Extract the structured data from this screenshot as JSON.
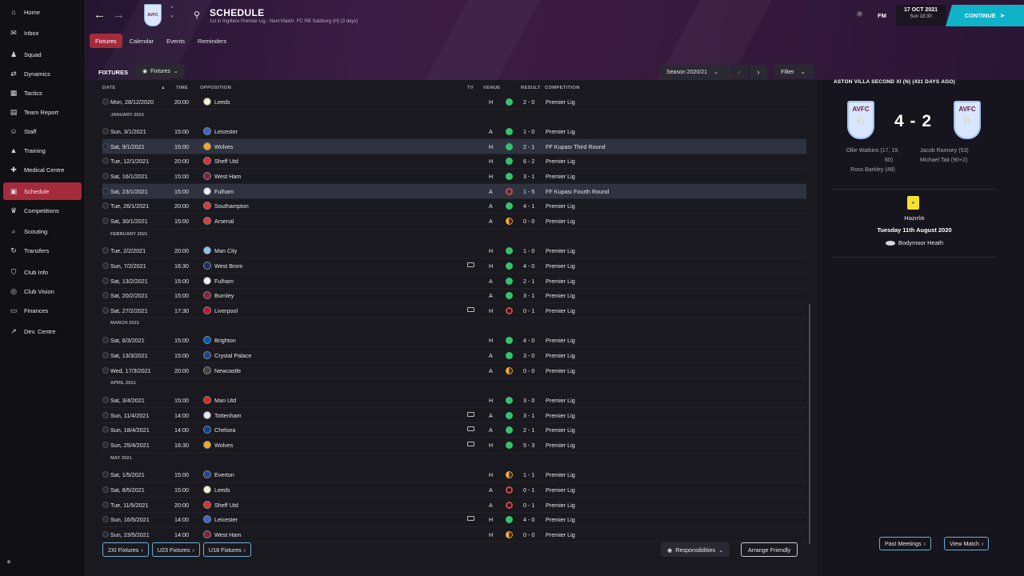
{
  "sidebar": {
    "items": [
      {
        "label": "Home",
        "icon": "⌂"
      },
      {
        "label": "Inbox",
        "icon": "✉"
      },
      {
        "label": "Squad",
        "icon": "♟"
      },
      {
        "label": "Dynamics",
        "icon": "⇄"
      },
      {
        "label": "Tactics",
        "icon": "▦"
      },
      {
        "label": "Team Report",
        "icon": "▤"
      },
      {
        "label": "Staff",
        "icon": "☺"
      },
      {
        "label": "Training",
        "icon": "▲"
      },
      {
        "label": "Medical Centre",
        "icon": "✚"
      },
      {
        "label": "Schedule",
        "icon": "▣"
      },
      {
        "label": "Competitions",
        "icon": "♛"
      },
      {
        "label": "Scouting",
        "icon": "⌕"
      },
      {
        "label": "Transfers",
        "icon": "↻"
      },
      {
        "label": "Club Info",
        "icon": "⛉"
      },
      {
        "label": "Club Vision",
        "icon": "◎"
      },
      {
        "label": "Finances",
        "icon": "▭"
      },
      {
        "label": "Dev. Centre",
        "icon": "↗"
      }
    ]
  },
  "header": {
    "title": "SCHEDULE",
    "subtitle": "1st in İngiltere Premier Lig - Next Match: FC RB Salzburg (H) (3 days)",
    "tabs": [
      "Fixtures",
      "Calendar",
      "Events",
      "Reminders"
    ],
    "fm_label": "FM",
    "date": "17 OCT 2021",
    "time": "Sun 18:30",
    "continue_label": "CONTINUE"
  },
  "fixtures": {
    "section_title": "FIXTURES",
    "view_label": "Fixtures",
    "season_label": "Season 2020/21",
    "filter_label": "Filter",
    "columns": {
      "date": "DATE",
      "time": "TIME",
      "opposition": "OPPOSITION",
      "tv": "TV",
      "venue": "VENUE",
      "result": "RESULT",
      "competition": "COMPETITION"
    },
    "rows": [
      {
        "type": "match",
        "date": "Mon, 28/12/2020",
        "time": "20:00",
        "opp": "Leeds",
        "crest": "#f4f0d6",
        "tv": false,
        "venue": "H",
        "res": "w",
        "score": "2 - 0",
        "comp": "Premier Lig"
      },
      {
        "type": "month",
        "label": "JANUARY 2021"
      },
      {
        "type": "match",
        "date": "Sun, 3/1/2021",
        "time": "15:00",
        "opp": "Leicester",
        "crest": "#3d64c9",
        "tv": false,
        "venue": "A",
        "res": "w",
        "score": "1 - 0",
        "comp": "Premier Lig"
      },
      {
        "type": "match",
        "date": "Sat, 9/1/2021",
        "time": "15:00",
        "opp": "Wolves",
        "crest": "#f5a623",
        "tv": false,
        "venue": "H",
        "res": "w",
        "score": "2 - 1",
        "comp": "FF Kupası Third Round",
        "hl": true
      },
      {
        "type": "match",
        "date": "Tue, 12/1/2021",
        "time": "20:00",
        "opp": "Sheff Utd",
        "crest": "#d93030",
        "tv": false,
        "venue": "H",
        "res": "w",
        "score": "6 - 2",
        "comp": "Premier Lig"
      },
      {
        "type": "match",
        "date": "Sat, 16/1/2021",
        "time": "15:00",
        "opp": "West Ham",
        "crest": "#7d2338",
        "tv": false,
        "venue": "H",
        "res": "w",
        "score": "3 - 1",
        "comp": "Premier Lig"
      },
      {
        "type": "match",
        "date": "Sat, 23/1/2021",
        "time": "15:00",
        "opp": "Fulham",
        "crest": "#f0f0f0",
        "tv": false,
        "venue": "A",
        "res": "l",
        "score": "1 - 5",
        "comp": "FF Kupası Fourth Round",
        "hl": true
      },
      {
        "type": "match",
        "date": "Tue, 26/1/2021",
        "time": "20:00",
        "opp": "Southampton",
        "crest": "#d63a3a",
        "tv": false,
        "venue": "A",
        "res": "w",
        "score": "4 - 1",
        "comp": "Premier Lig"
      },
      {
        "type": "match",
        "date": "Sat, 30/1/2021",
        "time": "15:00",
        "opp": "Arsenal",
        "crest": "#e03a3a",
        "tv": false,
        "venue": "A",
        "res": "d",
        "score": "0 - 0",
        "comp": "Premier Lig"
      },
      {
        "type": "month",
        "label": "FEBRUARY 2021"
      },
      {
        "type": "match",
        "date": "Tue, 2/2/2021",
        "time": "20:00",
        "opp": "Man City",
        "crest": "#8cc3ea",
        "tv": false,
        "venue": "H",
        "res": "w",
        "score": "1 - 0",
        "comp": "Premier Lig"
      },
      {
        "type": "match",
        "date": "Sun, 7/2/2021",
        "time": "16:30",
        "opp": "West Brom",
        "crest": "#1c2e6b",
        "tv": true,
        "venue": "H",
        "res": "w",
        "score": "4 - 0",
        "comp": "Premier Lig"
      },
      {
        "type": "match",
        "date": "Sat, 13/2/2021",
        "time": "15:00",
        "opp": "Fulham",
        "crest": "#f0f0f0",
        "tv": false,
        "venue": "A",
        "res": "w",
        "score": "2 - 1",
        "comp": "Premier Lig"
      },
      {
        "type": "match",
        "date": "Sat, 20/2/2021",
        "time": "15:00",
        "opp": "Burnley",
        "crest": "#8a1f3e",
        "tv": false,
        "venue": "A",
        "res": "w",
        "score": "3 - 1",
        "comp": "Premier Lig"
      },
      {
        "type": "match",
        "date": "Sat, 27/2/2021",
        "time": "17:30",
        "opp": "Liverpool",
        "crest": "#c8102e",
        "tv": true,
        "venue": "H",
        "res": "l",
        "score": "0 - 1",
        "comp": "Premier Lig"
      },
      {
        "type": "month",
        "label": "MARCH 2021"
      },
      {
        "type": "match",
        "date": "Sat, 6/3/2021",
        "time": "15:00",
        "opp": "Brighton",
        "crest": "#0057b8",
        "tv": false,
        "venue": "H",
        "res": "w",
        "score": "4 - 0",
        "comp": "Premier Lig"
      },
      {
        "type": "match",
        "date": "Sat, 13/3/2021",
        "time": "15:00",
        "opp": "Crystal Palace",
        "crest": "#1b458f",
        "tv": false,
        "venue": "A",
        "res": "w",
        "score": "3 - 0",
        "comp": "Premier Lig"
      },
      {
        "type": "match",
        "date": "Wed, 17/3/2021",
        "time": "20:00",
        "opp": "Newcastle",
        "crest": "#444444",
        "tv": false,
        "venue": "A",
        "res": "d",
        "score": "0 - 0",
        "comp": "Premier Lig"
      },
      {
        "type": "month",
        "label": "APRIL 2021"
      },
      {
        "type": "match",
        "date": "Sat, 3/4/2021",
        "time": "15:00",
        "opp": "Man Utd",
        "crest": "#da291c",
        "tv": false,
        "venue": "H",
        "res": "w",
        "score": "3 - 0",
        "comp": "Premier Lig"
      },
      {
        "type": "match",
        "date": "Sun, 11/4/2021",
        "time": "14:00",
        "opp": "Tottenham",
        "crest": "#e8e8f0",
        "tv": true,
        "venue": "A",
        "res": "w",
        "score": "3 - 1",
        "comp": "Premier Lig"
      },
      {
        "type": "match",
        "date": "Sun, 18/4/2021",
        "time": "14:00",
        "opp": "Chelsea",
        "crest": "#034694",
        "tv": true,
        "venue": "A",
        "res": "w",
        "score": "2 - 1",
        "comp": "Premier Lig"
      },
      {
        "type": "match",
        "date": "Sun, 25/4/2021",
        "time": "16:30",
        "opp": "Wolves",
        "crest": "#f5a623",
        "tv": true,
        "venue": "H",
        "res": "w",
        "score": "5 - 3",
        "comp": "Premier Lig"
      },
      {
        "type": "month",
        "label": "MAY 2021"
      },
      {
        "type": "match",
        "date": "Sat, 1/5/2021",
        "time": "15:00",
        "opp": "Everton",
        "crest": "#274488",
        "tv": false,
        "venue": "H",
        "res": "d",
        "score": "1 - 1",
        "comp": "Premier Lig"
      },
      {
        "type": "match",
        "date": "Sat, 8/5/2021",
        "time": "15:00",
        "opp": "Leeds",
        "crest": "#f4f0d6",
        "tv": false,
        "venue": "A",
        "res": "l",
        "score": "0 - 1",
        "comp": "Premier Lig"
      },
      {
        "type": "match",
        "date": "Tue, 11/5/2021",
        "time": "20:00",
        "opp": "Sheff Utd",
        "crest": "#d93030",
        "tv": false,
        "venue": "A",
        "res": "l",
        "score": "0 - 1",
        "comp": "Premier Lig"
      },
      {
        "type": "match",
        "date": "Sun, 16/5/2021",
        "time": "14:00",
        "opp": "Leicester",
        "crest": "#3d64c9",
        "tv": true,
        "venue": "H",
        "res": "w",
        "score": "4 - 0",
        "comp": "Premier Lig"
      },
      {
        "type": "match",
        "date": "Sun, 23/5/2021",
        "time": "14:00",
        "opp": "West Ham",
        "crest": "#7d2338",
        "tv": false,
        "venue": "H",
        "res": "d",
        "score": "0 - 0",
        "comp": "Premier Lig"
      }
    ],
    "bottom_links": [
      "2XI Fixtures",
      "U23 Fixtures",
      "U18 Fixtures"
    ],
    "responsibilities_label": "Responsibilities",
    "arrange_label": "Arrange Friendly"
  },
  "match_panel": {
    "title": "ASTON VILLA SECOND XI (N) (431 DAYS AGO)",
    "crest_text": "AVFC",
    "score": "4 - 2",
    "home_scorers": [
      "Ollie Watkins (17, 19,",
      "60)",
      "Ross Barkley (48)"
    ],
    "away_scorers": [
      "Jacob Ramsey (53)",
      "Michael Tait (90+2)"
    ],
    "competition": "Hazırlık",
    "date": "Tuesday 11th August 2020",
    "venue": "Bodymoor Heath",
    "past_meetings_label": "Past Meetings",
    "view_match_label": "View Match"
  }
}
